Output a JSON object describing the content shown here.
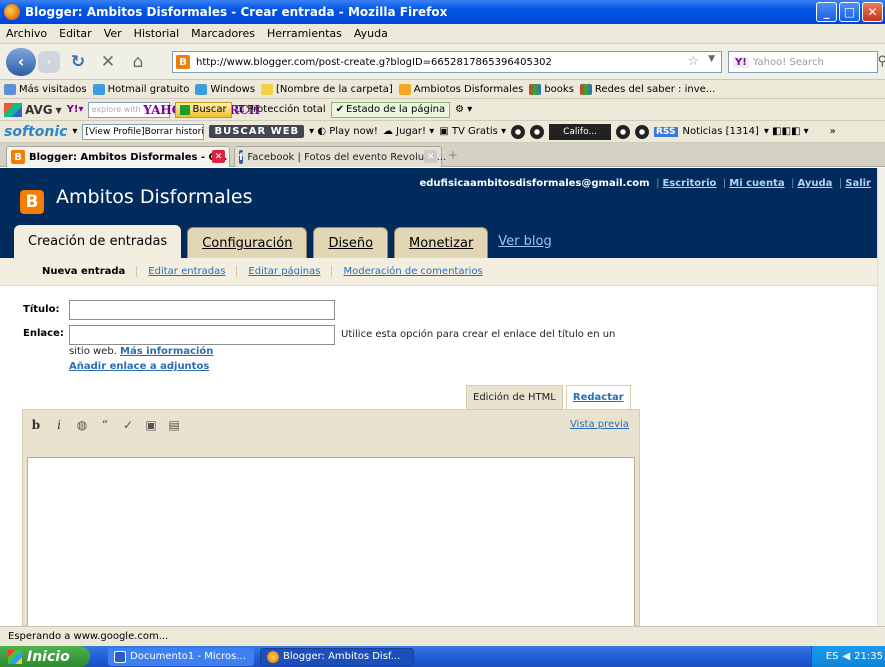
{
  "window": {
    "title": "Blogger: Ambitos Disformales - Crear entrada - Mozilla Firefox",
    "min": "_",
    "max": "□",
    "close": "✕"
  },
  "menu": [
    "Archivo",
    "Editar",
    "Ver",
    "Historial",
    "Marcadores",
    "Herramientas",
    "Ayuda"
  ],
  "nav": {
    "url": "http://www.blogger.com/post-create.g?blogID=6652817865396405302",
    "search_placeholder": "Yahoo! Search"
  },
  "bookmarks": [
    "Más visitados",
    "Hotmail gratuito",
    "Windows",
    "[Nombre de la carpeta]",
    "Ambiotos Disformales",
    "books",
    "Redes del saber : inve..."
  ],
  "avg_bar": {
    "brand": "AVG",
    "search_box": "explore with",
    "yahoo_search": "YAHOO! SEARCH",
    "buscar": "Buscar",
    "proteccion": "Protección total",
    "estado": "Estado de la página"
  },
  "softonic_bar": {
    "brand": "softonic",
    "profile_box": "[View Profile]Borrar histori",
    "buscar_web": "BUSCAR WEB",
    "play": "Play now!",
    "jugar": "Jugar!",
    "tv": "TV Gratis",
    "califo": "Califo...",
    "rss": "RSS",
    "noticias": "Noticias [1314]"
  },
  "tabs": [
    {
      "label": "Blogger: Ambitos Disformales - C..."
    },
    {
      "label": "Facebook | Fotos del evento Revolutio..."
    }
  ],
  "blogger": {
    "blog_title": "Ambitos Disformales",
    "email": "edufisicaambitosdisformales@gmail.com",
    "links": [
      "Escritorio",
      "Mi cuenta",
      "Ayuda",
      "Salir"
    ],
    "main_tabs": [
      "Creación de entradas",
      "Configuración",
      "Diseño",
      "Monetizar",
      "Ver blog"
    ],
    "sub_tabs": [
      "Nueva entrada",
      "Editar entradas",
      "Editar páginas",
      "Moderación de comentarios"
    ]
  },
  "form": {
    "titulo_label": "Título:",
    "enlace_label": "Enlace:",
    "enlace_hint_1": "Utilice esta opción para crear el enlace del título en un",
    "enlace_hint_2": "sitio web.",
    "mas_info": "Más información",
    "adjuntos": "Añadir enlace a adjuntos"
  },
  "editor": {
    "tab_html": "Edición de HTML",
    "tab_redactar": "Redactar",
    "preview": "Vista previa"
  },
  "status": "Esperando a www.google.com...",
  "taskbar": {
    "start": "Inicio",
    "items": [
      "Documento1 - Micros...",
      "Blogger: Ambitos Disf..."
    ],
    "lang": "ES",
    "time": "21:35"
  }
}
